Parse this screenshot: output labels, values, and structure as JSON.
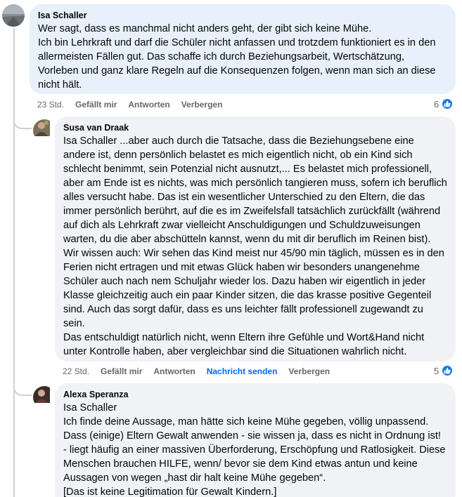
{
  "comments": [
    {
      "author": "Isa Schaller",
      "text": "Wer sagt, dass es manchmal nicht anders geht, der gibt sich keine Mühe.\nIch bin Lehrkraft und darf die Schüler nicht anfassen und trotzdem funktioniert es in den allermeisten Fällen gut. Das schaffe ich durch Beziehungsarbeit, Wertschätzung, Vorleben und ganz klare Regeln auf die Konsequenzen folgen, wenn man sich an diese nicht hält.",
      "time": "23 Std.",
      "like": "Gefällt mir",
      "reply": "Antworten",
      "hide": "Verbergen",
      "likes": "6"
    },
    {
      "author": "Susa van Draak",
      "mention": "Isa Schaller",
      "text": " ...aber auch durch die Tatsache, dass die Beziehungsebene eine andere ist, denn persönlich belastet es mich eigentlich nicht, ob ein Kind sich schlecht benimmt, sein Potenzial nicht ausnutzt,... Es belastet mich professionell, aber am Ende ist es nichts, was mich persönlich tangieren muss, sofern ich beruflich alles versucht habe. Das ist ein wesentlicher Unterschied zu den Eltern, die das immer persönlich berührt, auf die es im Zweifelsfall tatsächlich zurückfällt (während auf dich als Lehrkraft zwar vielleicht Anschuldigungen und Schuldzuweisungen warten, du die aber abschütteln kannst, wenn du mit dir beruflich im Reinen bist).\nWir wissen auch: Wir sehen das Kind meist nur 45/90 min täglich, müssen es in den Ferien nicht ertragen und mit etwas Glück haben wir besonders unangenehme Schüler auch nach nem Schuljahr wieder los. Dazu haben wir eigentlich in jeder Klasse gleichzeitig auch ein paar Kinder sitzen, die das krasse positive Gegenteil sind. Auch das sorgt dafür, dass es uns leichter fällt professionell zugewandt zu sein.\nDas entschuldigt natürlich nicht, wenn Eltern ihre Gefühle und Wort&Hand nicht unter Kontrolle haben, aber vergleichbar sind die Situationen wahrlich nicht.",
      "time": "22 Std.",
      "like": "Gefällt mir",
      "reply": "Antworten",
      "message": "Nachricht senden",
      "hide": "Verbergen",
      "likes": "5"
    },
    {
      "author": "Alexa Speranza",
      "mention": "Isa Schaller",
      "text": "Ich finde deine Aussage, man hätte sich keine Mühe gegeben, völlig unpassend.\nDass (einige) Eltern Gewalt anwenden - sie wissen ja, dass es nicht in Ordnung ist!\n- liegt häufig an einer massiven Überforderung, Erschöpfung und Ratlosigkeit. Diese Menschen brauchen HILFE, wenn/ bevor sie dem Kind etwas antun und keine Aussagen von wegen „hast dir halt keine Mühe gegeben“.\n[Das ist keine Legitimation für Gewalt Kindern.]"
    }
  ],
  "colors": {
    "bubble": "#f0f2f5",
    "bubble_first": "#e7f0fb",
    "secondary_text": "#65676b",
    "link": "#0866ff",
    "like_blue": "#1877f2"
  },
  "icons": [
    "thumbs-up-icon"
  ]
}
